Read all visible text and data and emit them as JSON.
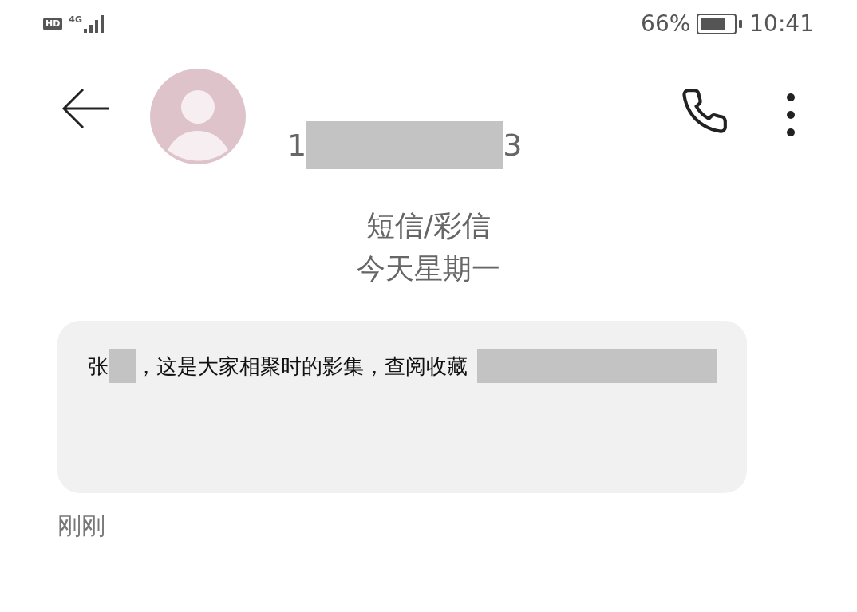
{
  "status_bar": {
    "hd": "HD",
    "network": "4G",
    "battery_percent": "66%",
    "time": "10:41"
  },
  "header": {
    "contact_parts": [
      {
        "kind": "text",
        "text": "1"
      },
      {
        "kind": "redacted"
      },
      {
        "kind": "text",
        "text": "3"
      }
    ]
  },
  "thread_info": {
    "channel": "短信/彩信",
    "date": "今天星期一"
  },
  "messages": [
    {
      "parts": [
        {
          "kind": "text",
          "text": "张"
        },
        {
          "kind": "redacted"
        },
        {
          "kind": "text",
          "text": "，这是大家相聚时的影集，查阅收藏"
        },
        {
          "kind": "redactedwide"
        }
      ],
      "time": "刚刚"
    }
  ]
}
